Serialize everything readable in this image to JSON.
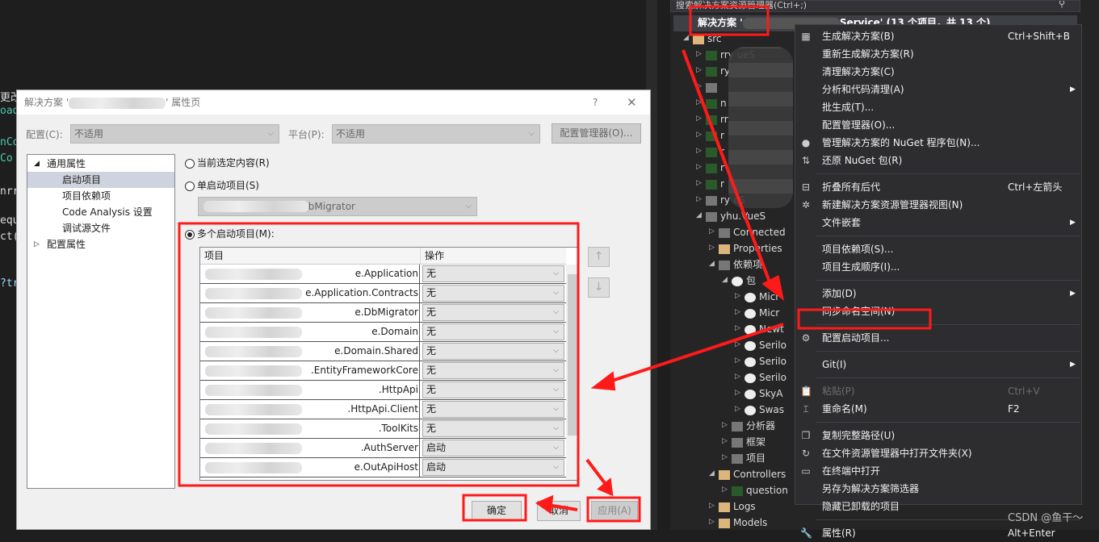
{
  "editor": {
    "fragments": [
      {
        "text": "更改",
        "color": "#dcdcdc"
      },
      {
        "text": "oad",
        "color": "#4ec9b0"
      },
      {
        "text": "nCo",
        "color": "#4ec9b0"
      },
      {
        "text": " Co",
        "color": "#4ec9b0"
      },
      {
        "text": "nrr",
        "color": "#dcdcdc"
      },
      {
        "text": "equ",
        "color": "#dcdcdc"
      },
      {
        "text": "ct(",
        "color": "#dcdcdc"
      },
      {
        "text": "?tr",
        "color": "#9cdcfe"
      }
    ]
  },
  "solution_explorer": {
    "search_placeholder": "搜索解决方案资源管理器(Ctrl+;)",
    "solution_label": "解决方案 '",
    "solution_suffix": "Service' (13 个项目，共 13 个)",
    "tree": [
      {
        "label": "src",
        "indent": 1,
        "icon": "folder-icon",
        "expanded": true
      },
      {
        "label": "rry  ueS",
        "indent": 2,
        "icon": "csharp-project-icon"
      },
      {
        "label": "ry",
        "indent": 2,
        "icon": "csharp-project-icon"
      },
      {
        "label": "",
        "indent": 2,
        "icon": "web-project-icon"
      },
      {
        "label": "n",
        "indent": 2,
        "icon": "csharp-project-icon"
      },
      {
        "label": "rr",
        "indent": 2,
        "icon": "csharp-project-icon"
      },
      {
        "label": "r",
        "indent": 2,
        "icon": "csharp-project-icon"
      },
      {
        "label": "r",
        "indent": 2,
        "icon": "csharp-project-icon"
      },
      {
        "label": "r",
        "indent": 2,
        "icon": "csharp-project-icon"
      },
      {
        "label": "r",
        "indent": 2,
        "icon": "csharp-project-icon"
      },
      {
        "label": "ry  eS",
        "indent": 2,
        "icon": "web-project-icon"
      },
      {
        "label": "yhu.VueS",
        "indent": 2,
        "icon": "web-project-icon",
        "expanded": true
      },
      {
        "label": "Connected",
        "indent": 3,
        "icon": "connected-services-icon"
      },
      {
        "label": "Properties",
        "indent": 3,
        "icon": "properties-folder-icon"
      },
      {
        "label": "依赖项",
        "indent": 3,
        "icon": "dependencies-icon",
        "expanded": true
      },
      {
        "label": "包",
        "indent": 4,
        "icon": "package-icon",
        "expanded": true
      },
      {
        "label": "Micr",
        "indent": 5,
        "icon": "package-icon"
      },
      {
        "label": "Micr",
        "indent": 5,
        "icon": "package-icon"
      },
      {
        "label": "Newt",
        "indent": 5,
        "icon": "package-icon"
      },
      {
        "label": "Serilo",
        "indent": 5,
        "icon": "package-icon"
      },
      {
        "label": "Serilo",
        "indent": 5,
        "icon": "package-icon"
      },
      {
        "label": "Serilo",
        "indent": 5,
        "icon": "package-icon"
      },
      {
        "label": "SkyA",
        "indent": 5,
        "icon": "package-icon"
      },
      {
        "label": "Swas",
        "indent": 5,
        "icon": "package-icon"
      },
      {
        "label": "分析器",
        "indent": 4,
        "icon": "analyzer-icon"
      },
      {
        "label": "框架",
        "indent": 4,
        "icon": "framework-icon"
      },
      {
        "label": "项目",
        "indent": 4,
        "icon": "project-ref-icon"
      },
      {
        "label": "Controllers",
        "indent": 3,
        "icon": "folder-icon",
        "expanded": true
      },
      {
        "label": "question",
        "indent": 4,
        "icon": "csharp-file-icon"
      },
      {
        "label": "Logs",
        "indent": 3,
        "icon": "folder-icon"
      },
      {
        "label": "Models",
        "indent": 3,
        "icon": "folder-icon"
      }
    ]
  },
  "context_menu": {
    "items": [
      {
        "label": "生成解决方案(B)",
        "shortcut": "Ctrl+Shift+B",
        "icon": "build-icon"
      },
      {
        "label": "重新生成解决方案(R)"
      },
      {
        "label": "清理解决方案(C)"
      },
      {
        "label": "分析和代码清理(A)",
        "submenu": true
      },
      {
        "label": "批生成(T)..."
      },
      {
        "label": "配置管理器(O)..."
      },
      {
        "label": "管理解决方案的 NuGet 程序包(N)...",
        "icon": "nuget-icon"
      },
      {
        "label": "还原 NuGet 包(R)",
        "icon": "restore-icon"
      },
      {
        "sep": true
      },
      {
        "label": "折叠所有后代",
        "shortcut": "Ctrl+左箭头",
        "icon": "collapse-icon"
      },
      {
        "label": "新建解决方案资源管理器视图(N)",
        "icon": "new-view-icon"
      },
      {
        "label": "文件嵌套",
        "submenu": true
      },
      {
        "sep": true
      },
      {
        "label": "项目依赖项(S)..."
      },
      {
        "label": "项目生成顺序(I)..."
      },
      {
        "sep": true
      },
      {
        "label": "添加(D)",
        "submenu": true
      },
      {
        "label": "同步命名空间(N)"
      },
      {
        "sep": true
      },
      {
        "label": "配置启动项目...",
        "icon": "gear-icon",
        "highlighted": true
      },
      {
        "sep": true
      },
      {
        "label": "Git(I)",
        "submenu": true
      },
      {
        "sep": true
      },
      {
        "label": "粘贴(P)",
        "shortcut": "Ctrl+V",
        "icon": "paste-icon",
        "disabled": true
      },
      {
        "label": "重命名(M)",
        "shortcut": "F2",
        "icon": "rename-icon"
      },
      {
        "sep": true
      },
      {
        "label": "复制完整路径(U)",
        "icon": "copy-icon"
      },
      {
        "label": "在文件资源管理器中打开文件夹(X)",
        "icon": "open-folder-icon"
      },
      {
        "label": "在终端中打开",
        "icon": "terminal-icon"
      },
      {
        "label": "另存为解决方案筛选器"
      },
      {
        "label": "隐藏已卸载的项目"
      },
      {
        "sep": true
      },
      {
        "label": "属性(R)",
        "shortcut": "Alt+Enter",
        "icon": "wrench-icon"
      }
    ]
  },
  "dialog": {
    "title_prefix": "解决方案 '",
    "title_suffix": "' 属性页",
    "help": "?",
    "close": "✕",
    "config_label": "配置(C):",
    "config_value": "不适用",
    "platform_label": "平台(P):",
    "platform_value": "不适用",
    "config_manager": "配置管理器(O)...",
    "nav": [
      {
        "label": "通用属性",
        "level": 0,
        "expander": "◢"
      },
      {
        "label": "启动项目",
        "level": 1,
        "selected": true
      },
      {
        "label": "项目依赖项",
        "level": 1
      },
      {
        "label": "Code Analysis 设置",
        "level": 1
      },
      {
        "label": "调试源文件",
        "level": 1
      },
      {
        "label": "配置属性",
        "level": 0,
        "expander": "▷"
      }
    ],
    "radio_current": "当前选定内容(R)",
    "radio_single": "单启动项目(S)",
    "single_value": "DbMigrator",
    "radio_multiple": "多个启动项目(M):",
    "selected_radio": "multiple",
    "grid_headers": [
      "项目",
      "操作"
    ],
    "rows": [
      {
        "project": "e.Application",
        "action": "无"
      },
      {
        "project": "e.Application.Contracts",
        "action": "无"
      },
      {
        "project": "e.DbMigrator",
        "action": "无"
      },
      {
        "project": "e.Domain",
        "action": "无"
      },
      {
        "project": "e.Domain.Shared",
        "action": "无"
      },
      {
        "project": ".EntityFrameworkCore",
        "action": "无"
      },
      {
        "project": ".HttpApi",
        "action": "无"
      },
      {
        "project": ".HttpApi.Client",
        "action": "无"
      },
      {
        "project": ".ToolKits",
        "action": "无"
      },
      {
        "project": ".AuthServer",
        "action": "启动"
      },
      {
        "project": "e.OutApiHost",
        "action": "启动"
      }
    ],
    "ok": "确定",
    "cancel": "取消",
    "apply": "应用(A)"
  },
  "watermark": "CSDN @鱼干～",
  "colors": {
    "annotation": "#ff1a1a",
    "menu_bg": "#2d2d30",
    "dialog_bg": "#f0f0f0"
  }
}
